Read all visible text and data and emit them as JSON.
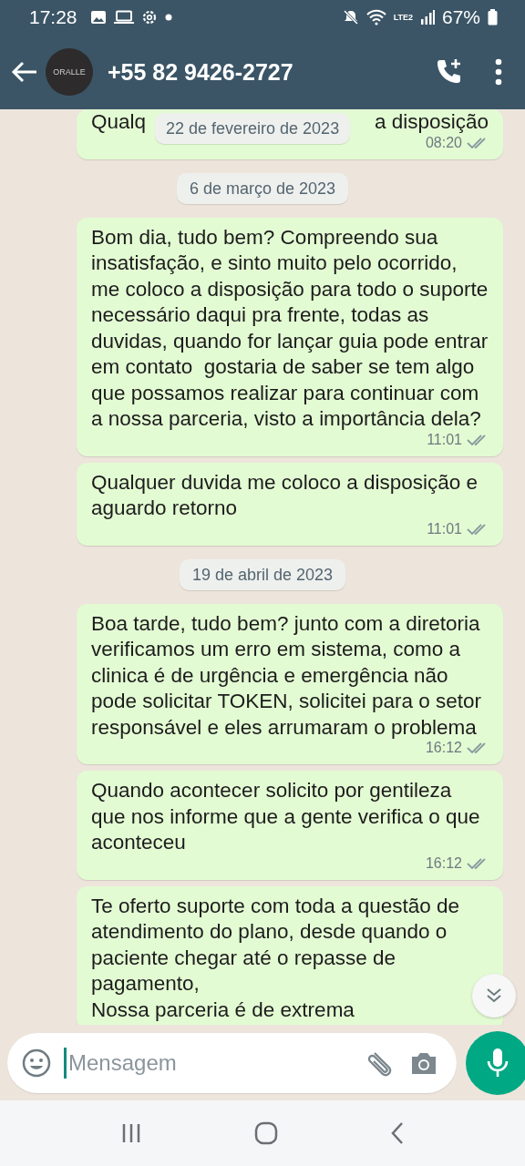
{
  "status_bar": {
    "time": "17:28",
    "network": "LTE2",
    "battery": "67%"
  },
  "header": {
    "avatar_logo": "ORALLE",
    "contact": "+55 82 9426-2727"
  },
  "sticky_date": "22 de fevereiro de 2023",
  "messages": [
    {
      "kind": "partial",
      "text_start": "Qualq",
      "text_end": "a disposição",
      "time": "08:20",
      "read": false
    },
    {
      "kind": "date",
      "text": "6 de março de 2023"
    },
    {
      "kind": "bubble",
      "text": "Bom dia, tudo bem? Compreendo sua insatisfação, e sinto muito pelo ocorrido, me coloco a disposição para todo o suporte necessário daqui pra frente, todas as duvidas, quando for lançar guia pode entrar em contato  gostaria de saber se tem algo que possamos realizar para continuar com a nossa parceria, visto a importância dela?",
      "time": "11:01",
      "read": false
    },
    {
      "kind": "bubble",
      "text": "Qualquer duvida me coloco a disposição e aguardo retorno",
      "time": "11:01",
      "read": false
    },
    {
      "kind": "date",
      "text": "19 de abril de 2023"
    },
    {
      "kind": "bubble",
      "text": "Boa tarde, tudo bem? junto com a diretoria verificamos um erro em sistema, como a clinica é de urgência e emergência não pode solicitar TOKEN, solicitei para o setor responsável e eles arrumaram o problema",
      "time": "16:12",
      "read": false
    },
    {
      "kind": "bubble",
      "text": "Quando acontecer solicito por gentileza que nos informe que a gente verifica o que aconteceu",
      "time": "16:12",
      "read": false
    },
    {
      "kind": "bubble",
      "text": "Te oferto suporte com toda a questão de atendimento do plano, desde quando o paciente chegar até o repasse de pagamento,\nNossa parceria é de extrema"
    }
  ],
  "composer": {
    "placeholder": "Mensagem"
  }
}
